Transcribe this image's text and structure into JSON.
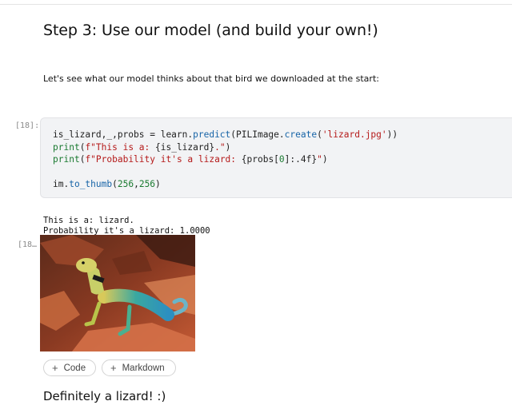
{
  "heading": "Step 3: Use our model (and build your own!)",
  "intro": "Let's see what our model thinks about that bird we downloaded at the start:",
  "cell_in": {
    "prompt": "[18]:",
    "code": {
      "l1_a": "is_lizard,_,probs = learn.",
      "l1_fn": "predict",
      "l1_b": "(PILImage.",
      "l1_fn2": "create",
      "l1_c": "(",
      "l1_str": "'lizard.jpg'",
      "l1_d": "))",
      "l2_kw": "print",
      "l2_a": "(",
      "l2_str": "f\"This is a: ",
      "l2_b": "{is_lizard}",
      "l2_str2": ".\"",
      "l2_c": ")",
      "l3_kw": "print",
      "l3_a": "(",
      "l3_str": "f\"Probability it's a lizard: ",
      "l3_b": "{probs[",
      "l3_num": "0",
      "l3_c": "]:.4f}",
      "l3_str2": "\"",
      "l3_d": ")",
      "l5_a": "im.",
      "l5_fn": "to_thumb",
      "l5_b": "(",
      "l5_n1": "256",
      "l5_c": ",",
      "l5_n2": "256",
      "l5_d": ")"
    }
  },
  "cell_out": {
    "prompt": "[18…",
    "line1": "This is a: lizard.",
    "line2": "Probability it's a lizard: 1.0000"
  },
  "buttons": {
    "add_code": "Code",
    "add_markdown": "Markdown",
    "plus": "+"
  },
  "final_text": "Definitely a lizard! :)",
  "colors": {
    "cell_bg": "#f2f3f5",
    "function": "#1764a7",
    "string": "#b51a1a",
    "keyword": "#1a7a30"
  }
}
